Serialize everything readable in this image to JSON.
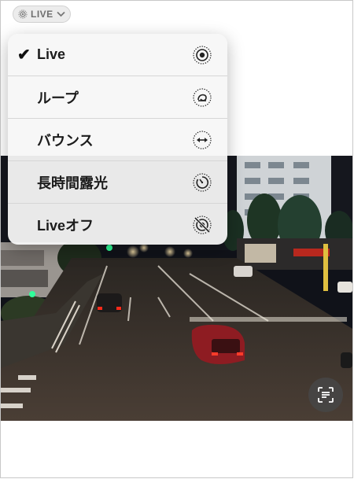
{
  "badge": {
    "label": "LIVE",
    "icon": "live-photo-icon"
  },
  "menu": {
    "items": [
      {
        "label": "Live",
        "checked": true,
        "icon": "live-photo-icon"
      },
      {
        "label": "ループ",
        "checked": false,
        "icon": "loop-icon"
      },
      {
        "label": "バウンス",
        "checked": false,
        "icon": "bounce-icon"
      },
      {
        "label": "長時間露光",
        "checked": false,
        "icon": "long-exposure-icon"
      },
      {
        "label": "Liveオフ",
        "checked": false,
        "icon": "live-off-icon"
      }
    ]
  },
  "check_mark": "✔",
  "live_text_button": {
    "icon": "live-text-scan-icon"
  }
}
